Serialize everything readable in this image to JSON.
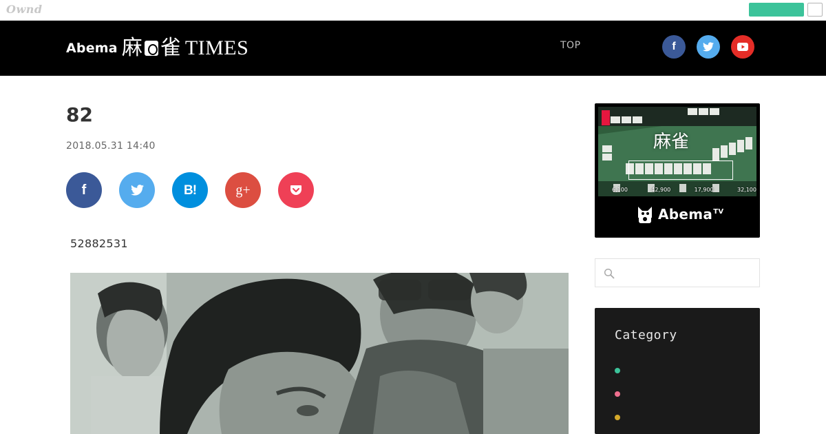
{
  "owned_bar": {
    "logo": "Ownd",
    "follow_color": "#3cc39a"
  },
  "header": {
    "brand": {
      "abema": "Abema",
      "ma": "麻",
      "jan": "雀",
      "times": "TIMES"
    },
    "nav": {
      "top": "TOP"
    },
    "social": [
      {
        "icon": "facebook-icon",
        "glyph": "f",
        "color": "#3b5998"
      },
      {
        "icon": "twitter-icon",
        "glyph": "t",
        "color": "#55acee"
      },
      {
        "icon": "youtube-icon",
        "glyph": "▶",
        "color": "#e52d27"
      }
    ]
  },
  "article": {
    "title": "82",
    "date": "2018.05.31 14:40",
    "body_text": "52882531",
    "share": [
      {
        "icon": "facebook-share-icon",
        "glyph": "f",
        "color": "#3b5998"
      },
      {
        "icon": "twitter-share-icon",
        "glyph": "t",
        "color": "#55acee"
      },
      {
        "icon": "hatena-bookmark-icon",
        "glyph": "B!",
        "color": "#008fde"
      },
      {
        "icon": "google-plus-icon",
        "glyph": "g+",
        "color": "#dc4e41"
      },
      {
        "icon": "pocket-icon",
        "glyph": "⌄",
        "color": "#ef4056"
      }
    ]
  },
  "sidebar": {
    "banner": {
      "title": "麻雀",
      "scores": [
        "6,100",
        "42,900",
        "17,900",
        "32,100"
      ],
      "brand": "Abema",
      "brand_sup": "TV"
    },
    "search": {
      "placeholder": ""
    },
    "category": {
      "title": "Category",
      "items": [
        {
          "label": "",
          "color": "#3cc39a"
        },
        {
          "label": "",
          "color": "#ef6f8e"
        },
        {
          "label": "",
          "color": "#d4a82a"
        }
      ]
    }
  }
}
